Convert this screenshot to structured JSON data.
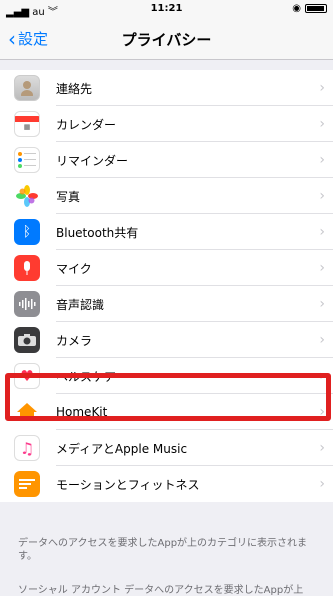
{
  "status": {
    "carrier": "au",
    "time": "11:21"
  },
  "nav": {
    "back_label": "設定",
    "title": "プライバシー"
  },
  "rows": [
    {
      "label": "連絡先",
      "icon": "contacts-icon"
    },
    {
      "label": "カレンダー",
      "icon": "calendar-icon"
    },
    {
      "label": "リマインダー",
      "icon": "reminders-icon"
    },
    {
      "label": "写真",
      "icon": "photos-icon"
    },
    {
      "label": "Bluetooth共有",
      "icon": "bluetooth-icon"
    },
    {
      "label": "マイク",
      "icon": "microphone-icon"
    },
    {
      "label": "音声認識",
      "icon": "speech-recognition-icon"
    },
    {
      "label": "カメラ",
      "icon": "camera-icon"
    },
    {
      "label": "ヘルスケア",
      "icon": "health-icon"
    },
    {
      "label": "HomeKit",
      "icon": "homekit-icon"
    },
    {
      "label": "メディアとApple Music",
      "icon": "music-icon"
    },
    {
      "label": "モーションとフィットネス",
      "icon": "motion-icon"
    }
  ],
  "footer_text": "データへのアクセスを要求したAppが上のカテゴリに表示されます。",
  "footer_text2": "ソーシャル アカウント データへのアクセスを要求したAppが上",
  "colors": {
    "accent": "#007aff",
    "highlight": "#e02020"
  }
}
